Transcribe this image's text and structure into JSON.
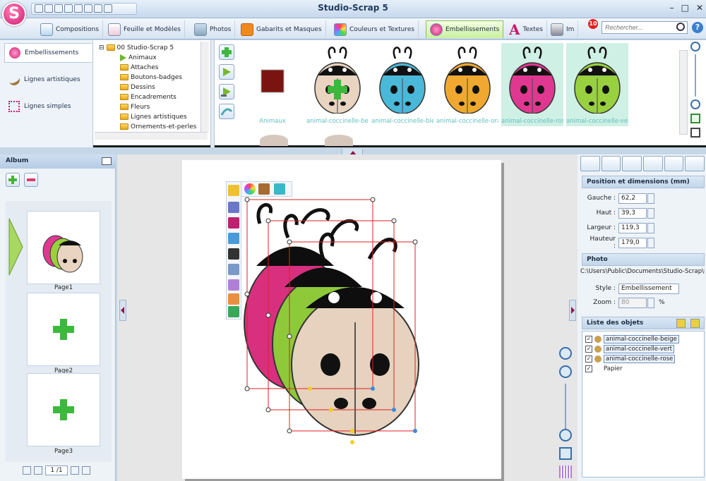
{
  "app": {
    "logo_letter": "S",
    "title": "Studio-Scrap 5",
    "window_controls": [
      "–",
      "□",
      "✕"
    ]
  },
  "tabs": [
    {
      "label": "Compositions",
      "icon": "compositions-icon"
    },
    {
      "label": "Feuille et Modèles",
      "icon": "sheet-icon"
    },
    {
      "label": "Photos",
      "icon": "photos-icon"
    },
    {
      "label": "Gabarits et Masques",
      "icon": "puzzle-icon"
    },
    {
      "label": "Couleurs et Textures",
      "icon": "palette-icon"
    },
    {
      "label": "Embellissements",
      "icon": "flower-icon",
      "active": true
    },
    {
      "label": "Textes",
      "icon": "text-icon"
    },
    {
      "label": "Im",
      "icon": "print-icon"
    }
  ],
  "notifications": {
    "count": "10"
  },
  "search": {
    "placeholder": "Rechercher..."
  },
  "categories": [
    {
      "label": "Embellissements",
      "active": true
    },
    {
      "label": "Lignes artistiques"
    },
    {
      "label": "Lignes simples"
    }
  ],
  "tree": {
    "root": "00 Studio-Scrap 5",
    "items": [
      "Animaux",
      "Attaches",
      "Boutons-badges",
      "Dessins",
      "Encadrements",
      "Fleurs",
      "Lignes artistiques",
      "Ornements-et-perles"
    ]
  },
  "gallery": {
    "items": [
      {
        "label": "Animaux",
        "type": "swatch",
        "color": "#7a1410"
      },
      {
        "label": "animal-coccinelle-beige",
        "body": "#e8d4c0",
        "sel": false,
        "plus": true
      },
      {
        "label": "animal-coccinelle-bleu",
        "body": "#4ab8d8",
        "sel": false
      },
      {
        "label": "animal-coccinelle-orange",
        "body": "#f0a830",
        "sel": false
      },
      {
        "label": "animal-coccinelle-rose",
        "body": "#e03890",
        "sel": true
      },
      {
        "label": "animal-coccinelle-vert",
        "body": "#98d040",
        "sel": true
      }
    ]
  },
  "album": {
    "title": "Album",
    "pages": [
      {
        "label": "Page1"
      },
      {
        "label": "Page2"
      },
      {
        "label": "Page3"
      }
    ],
    "pager": "1 /1"
  },
  "position": {
    "title": "Position et dimensions (mm)",
    "fields": [
      {
        "label": "Gauche :",
        "value": "62,2"
      },
      {
        "label": "Haut :",
        "value": "39,3"
      },
      {
        "label": "Largeur :",
        "value": "119,3"
      },
      {
        "label": "Hauteur :",
        "value": "179,0"
      }
    ]
  },
  "photo": {
    "title": "Photo",
    "path": "C:\\Users\\Public\\Documents\\Studio-Scrap\\i",
    "style_label": "Style :",
    "style_value": "Embellissement",
    "zoom_label": "Zoom :",
    "zoom_value": "80",
    "zoom_unit": "%"
  },
  "objects": {
    "title": "Liste des objets",
    "items": [
      {
        "name": "animal-coccinelle-beige",
        "checked": true
      },
      {
        "name": "animal-coccinelle-vert",
        "checked": true
      },
      {
        "name": "animal-coccinelle-rose",
        "checked": true
      },
      {
        "name": "Papier",
        "checked": true
      }
    ]
  },
  "colors": {
    "accent": "#d21a73",
    "selection": "#e02020",
    "plus": "#3cb83c"
  }
}
